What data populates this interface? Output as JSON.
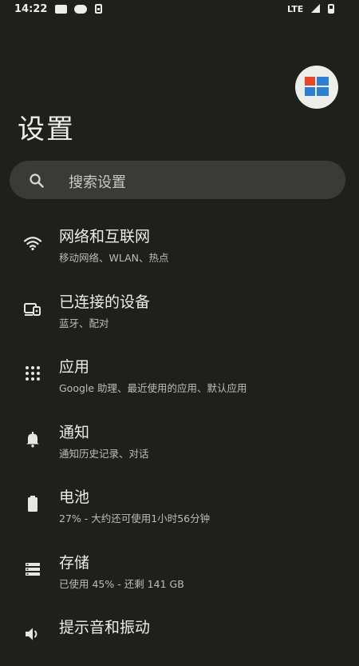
{
  "status_bar": {
    "time": "14:22",
    "network": "LTE",
    "icons": [
      "mail-icon",
      "cloud-icon",
      "sim-icon",
      "signal-icon",
      "battery-icon"
    ]
  },
  "profile": {
    "avatar_icon": "windows-logo-icon"
  },
  "page": {
    "title": "设置"
  },
  "search": {
    "placeholder": "搜索设置",
    "icon": "search-icon"
  },
  "settings": [
    {
      "icon": "wifi-icon",
      "title": "网络和互联网",
      "subtitle": "移动网络、WLAN、热点"
    },
    {
      "icon": "connected-devices-icon",
      "title": "已连接的设备",
      "subtitle": "蓝牙、配对"
    },
    {
      "icon": "apps-grid-icon",
      "title": "应用",
      "subtitle": "Google 助理、最近使用的应用、默认应用"
    },
    {
      "icon": "bell-icon",
      "title": "通知",
      "subtitle": "通知历史记录、对话"
    },
    {
      "icon": "battery-icon",
      "title": "电池",
      "subtitle": "27% - 大约还可使用1小时56分钟"
    },
    {
      "icon": "storage-icon",
      "title": "存储",
      "subtitle": "已使用 45% - 还剩 141 GB"
    },
    {
      "icon": "sound-icon",
      "title": "提示音和振动",
      "subtitle": ""
    }
  ],
  "colors": {
    "background": "#1f1f1d",
    "search_bar": "#3a3b38",
    "primary_text": "#ededea",
    "secondary_text": "#bdbdb8"
  }
}
